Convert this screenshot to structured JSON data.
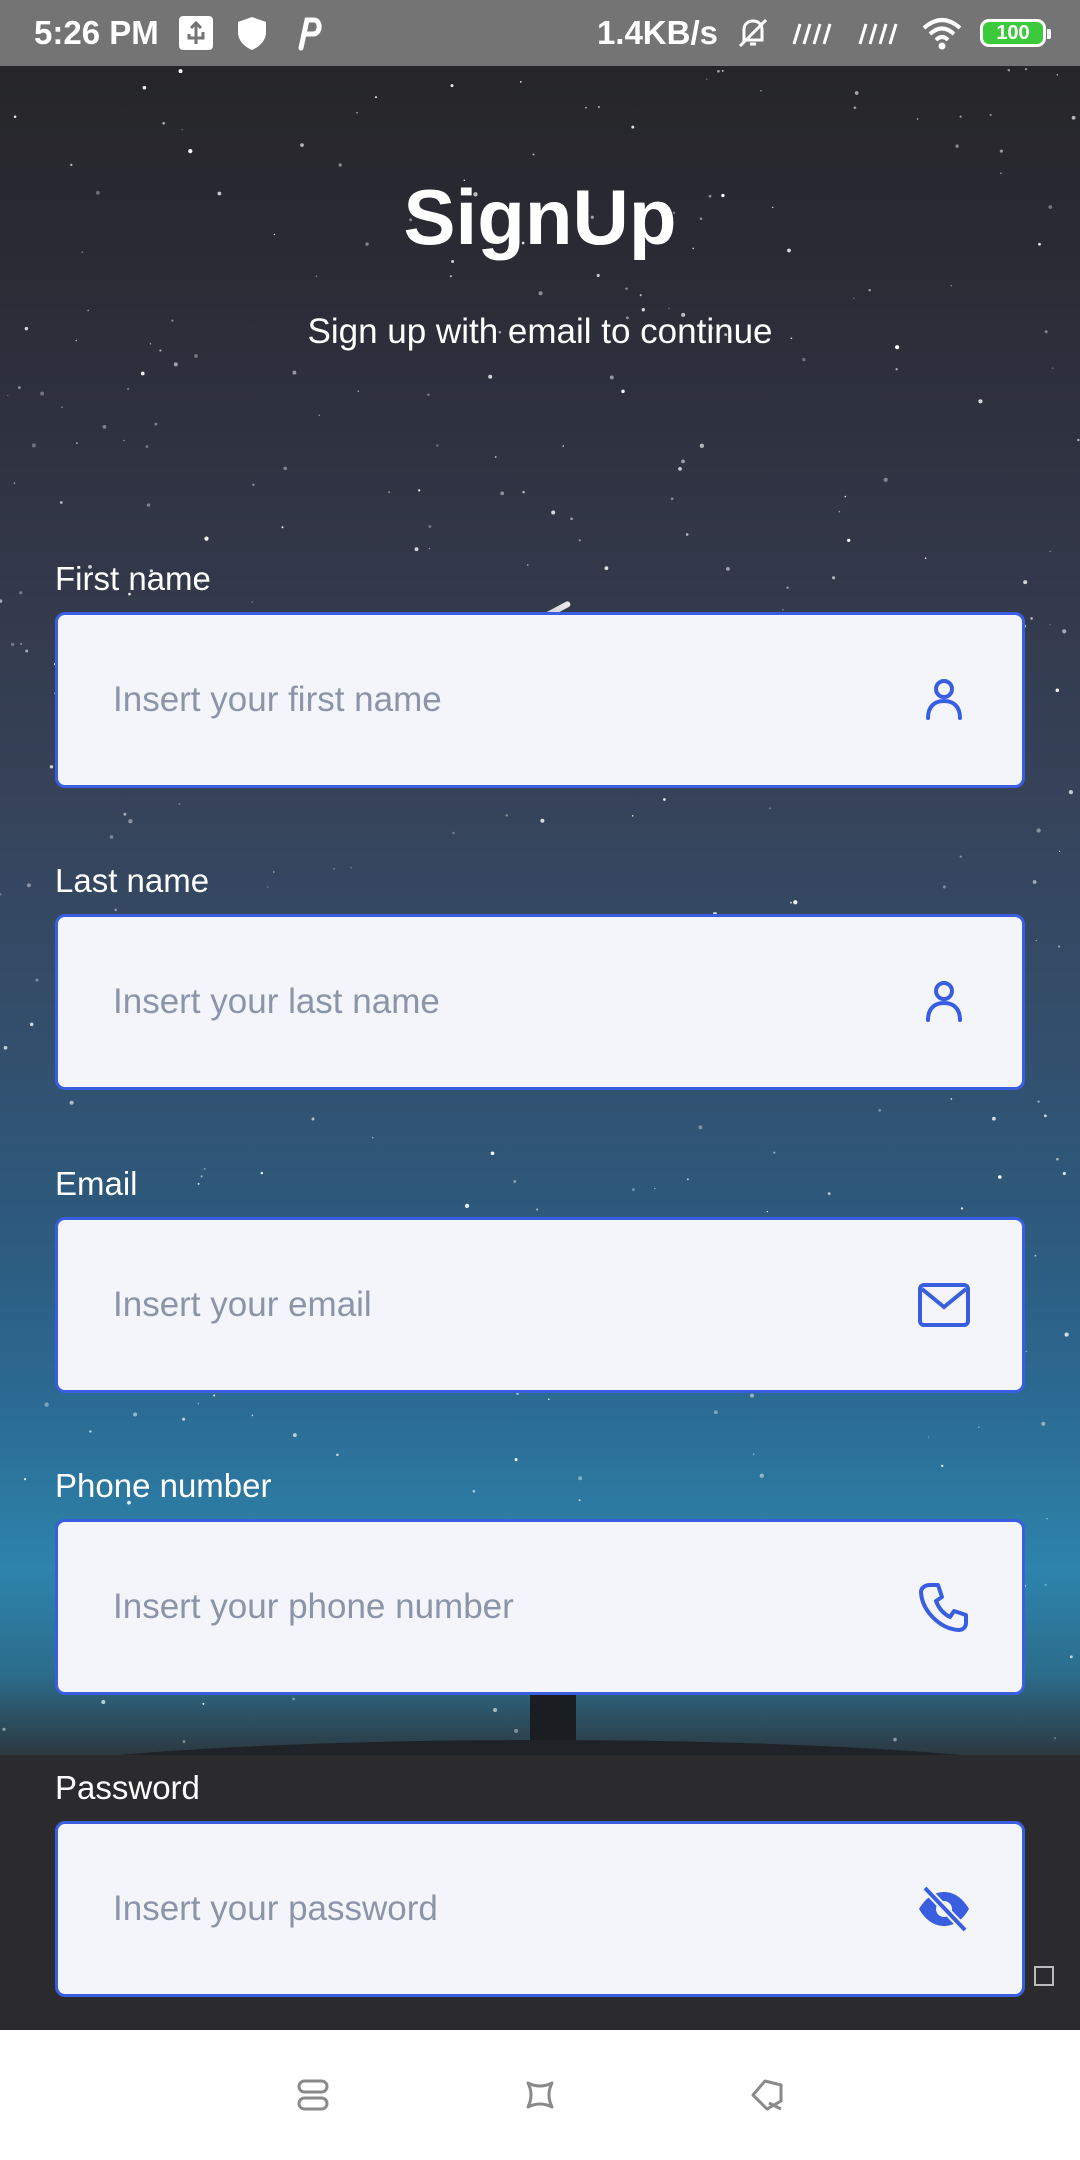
{
  "status_bar": {
    "time": "5:26 PM",
    "net_speed": "1.4KB/s",
    "battery": "100",
    "icons_left": [
      "usb-icon",
      "shield-icon",
      "p-icon"
    ],
    "icons_right": [
      "mute-bell-icon",
      "signal-icon",
      "signal-icon",
      "wifi-icon",
      "battery-icon"
    ]
  },
  "header": {
    "title": "SignUp",
    "subtitle": "Sign up with email to continue"
  },
  "form": {
    "first_name": {
      "label": "First name",
      "placeholder": "Insert your first name",
      "icon": "user-icon"
    },
    "last_name": {
      "label": "Last name",
      "placeholder": "Insert your last name",
      "icon": "user-icon"
    },
    "email": {
      "label": "Email",
      "placeholder": "Insert your email",
      "icon": "mail-icon"
    },
    "phone": {
      "label": "Phone number",
      "placeholder": "Insert your phone number",
      "icon": "phone-icon"
    },
    "password": {
      "label": "Password",
      "placeholder": "Insert your password",
      "icon": "eye-off-icon"
    }
  },
  "colors": {
    "accent": "#3a5ee0",
    "field_bg": "#f3f5fb",
    "placeholder": "#8c94a8",
    "status_bar": "#747474"
  },
  "nav_bar": {
    "buttons": [
      "menu-icon",
      "home-icon",
      "back-icon"
    ]
  }
}
